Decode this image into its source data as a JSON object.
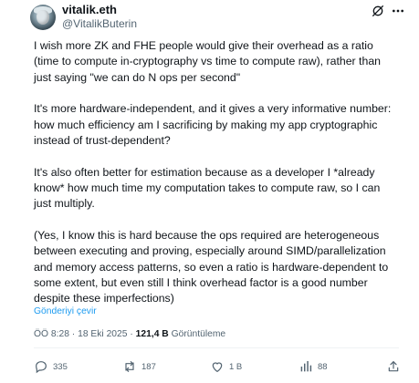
{
  "author": {
    "name": "vitalik.eth",
    "handle": "@VitalikButerin"
  },
  "header_icons": [
    "grok-icon",
    "more-icon"
  ],
  "tweet": {
    "paragraphs": [
      "I wish more ZK and FHE people would give their overhead as a ratio (time to compute in-cryptography vs time to compute raw), rather than just saying \"we can do N ops per second\"",
      "It's more hardware-independent, and it gives a very informative number: how much efficiency am I sacrificing by making my app cryptographic instead of trust-dependent?",
      "It's also often better for estimation because as a developer I *already know* how much time my computation takes to compute raw, so I can just multiply.",
      "(Yes, I know this is hard because the ops required are heterogeneous between executing and proving, especially around SIMD/parallelization and memory access patterns, so even a ratio is hardware-dependent to some extent, but even still I think overhead factor is a good number despite these imperfections)"
    ],
    "translate_label": "Gönderiyi çevir",
    "time": "ÖÖ 8:28",
    "date": "18 Eki 2025",
    "views_count": "121,4 B",
    "views_label": "Görüntüleme"
  },
  "actions": {
    "replies": "335",
    "reposts": "187",
    "likes": "1 B",
    "bookmarks": "88"
  },
  "colors": {
    "link": "#1d9bf0",
    "secondary": "#536471",
    "text": "#0f1419"
  }
}
